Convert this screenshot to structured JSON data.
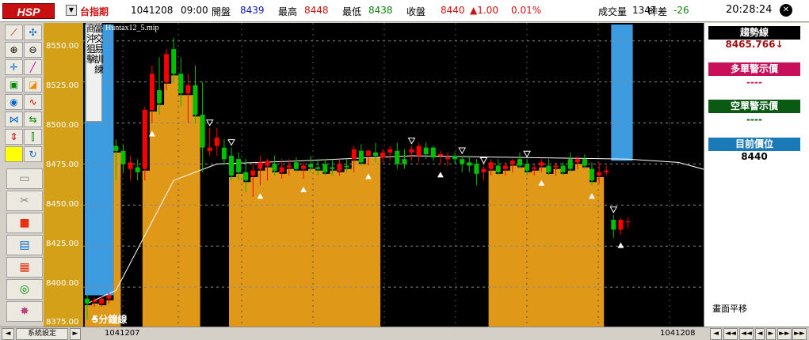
{
  "app": {
    "logo": "HSP"
  },
  "quote": {
    "symbol": "台指期",
    "date": "1041208",
    "time": "09:00",
    "open_label": "開盤",
    "open": "8439",
    "high_label": "最高",
    "high": "8448",
    "low_label": "最低",
    "low": "8438",
    "close_label": "收盤",
    "close": "8440",
    "change": "▲1.00",
    "change_pct": "0.01%",
    "volume_label": "成交量",
    "volume": "1347",
    "diff_label": "昨差",
    "diff": "-26",
    "clock": "20:28:24"
  },
  "colors": {
    "accent_up": "#ff0000",
    "accent_down": "#00c000",
    "yaxis_bg": "#d4a017",
    "zone_orange": "#e09818",
    "zone_blue": "#3d9be0"
  },
  "toolbar": {
    "icons": [
      "trend-line-icon",
      "cursor-icon",
      "zoom-in-icon",
      "zoom-out-icon",
      "crosshair-icon",
      "pencil-icon",
      "lock-icon",
      "highlight-icon",
      "gauge-icon",
      "wave-icon",
      "zigzag-icon",
      "arrows-icon",
      "up-down-arrow-icon",
      "candle-icon",
      "color-box-icon",
      "refresh-icon"
    ],
    "wide": [
      "folder-icon",
      "scissors-icon",
      "stop-icon",
      "window-icon",
      "grid-icon",
      "binoculars-icon",
      "explode-icon"
    ]
  },
  "yaxis": {
    "labels": [
      "8550.00",
      "8525.00",
      "8500.00",
      "8475.00",
      "8450.00",
      "8425.00",
      "8400.00",
      "8375.00"
    ]
  },
  "chart": {
    "vertical_tab": {
      "col1": "商沖狙擊",
      "col2": "當交易訓練"
    },
    "filename": "Huntax12_5.mip",
    "bottom_label": "5分鐘線"
  },
  "right_panel": {
    "trend_label": "趨勢線",
    "trend_value": "8465.766↓",
    "long_label": "多單警示價",
    "long_value": "----",
    "short_label": "空單警示價",
    "short_value": "----",
    "position_label": "目前價位",
    "position_value": "8440",
    "pan_label": "畫面平移",
    "header_colors": [
      "#000000",
      "#c8105a",
      "#0a5a14",
      "#1a7ab8"
    ]
  },
  "statusbar": {
    "settings": "系統設定",
    "left_date": "1041207",
    "right_date": "1041208",
    "nav": [
      "◄",
      "◄◄",
      "◄◄",
      "◄",
      "►",
      "►►",
      "►►",
      "►"
    ]
  },
  "chart_data": {
    "type": "candlestick",
    "ylim": [
      8375,
      8560
    ],
    "yticks": [
      8375,
      8400,
      8425,
      8450,
      8475,
      8500,
      8525,
      8550
    ],
    "candles": [
      {
        "o": 8393,
        "h": 8395,
        "l": 8380,
        "c": 8390
      },
      {
        "o": 8391,
        "h": 8394,
        "l": 8388,
        "c": 8392
      },
      {
        "o": 8390,
        "h": 8394,
        "l": 8388,
        "c": 8393
      },
      {
        "o": 8393,
        "h": 8397,
        "l": 8390,
        "c": 8395
      },
      {
        "o": 8486,
        "h": 8490,
        "l": 8465,
        "c": 8483
      },
      {
        "o": 8483,
        "h": 8487,
        "l": 8470,
        "c": 8475
      },
      {
        "o": 8472,
        "h": 8480,
        "l": 8465,
        "c": 8476
      },
      {
        "o": 8473,
        "h": 8478,
        "l": 8465,
        "c": 8470
      },
      {
        "o": 8472,
        "h": 8510,
        "l": 8465,
        "c": 8508
      },
      {
        "o": 8508,
        "h": 8535,
        "l": 8500,
        "c": 8530
      },
      {
        "o": 8520,
        "h": 8540,
        "l": 8505,
        "c": 8512
      },
      {
        "o": 8525,
        "h": 8545,
        "l": 8520,
        "c": 8542
      },
      {
        "o": 8545,
        "h": 8552,
        "l": 8525,
        "c": 8530
      },
      {
        "o": 8530,
        "h": 8540,
        "l": 8510,
        "c": 8518
      },
      {
        "o": 8518,
        "h": 8530,
        "l": 8500,
        "c": 8523
      },
      {
        "o": 8523,
        "h": 8535,
        "l": 8500,
        "c": 8505
      },
      {
        "o": 8505,
        "h": 8525,
        "l": 8470,
        "c": 8485
      },
      {
        "o": 8483,
        "h": 8497,
        "l": 8480,
        "c": 8485
      },
      {
        "o": 8486,
        "h": 8497,
        "l": 8480,
        "c": 8491
      },
      {
        "o": 8485,
        "h": 8490,
        "l": 8475,
        "c": 8478
      },
      {
        "o": 8480,
        "h": 8485,
        "l": 8465,
        "c": 8468
      },
      {
        "o": 8478,
        "h": 8482,
        "l": 8465,
        "c": 8470
      },
      {
        "o": 8470,
        "h": 8478,
        "l": 8458,
        "c": 8465
      },
      {
        "o": 8468,
        "h": 8475,
        "l": 8455,
        "c": 8471
      },
      {
        "o": 8472,
        "h": 8480,
        "l": 8462,
        "c": 8476
      },
      {
        "o": 8474,
        "h": 8478,
        "l": 8465,
        "c": 8477
      },
      {
        "o": 8475,
        "h": 8480,
        "l": 8468,
        "c": 8471
      },
      {
        "o": 8470,
        "h": 8478,
        "l": 8466,
        "c": 8473
      },
      {
        "o": 8473,
        "h": 8478,
        "l": 8468,
        "c": 8474
      },
      {
        "o": 8476,
        "h": 8479,
        "l": 8470,
        "c": 8472
      },
      {
        "o": 8472,
        "h": 8476,
        "l": 8466,
        "c": 8474
      },
      {
        "o": 8475,
        "h": 8480,
        "l": 8470,
        "c": 8473
      },
      {
        "o": 8473,
        "h": 8478,
        "l": 8468,
        "c": 8472
      },
      {
        "o": 8475,
        "h": 8478,
        "l": 8468,
        "c": 8470
      },
      {
        "o": 8473,
        "h": 8478,
        "l": 8468,
        "c": 8472
      },
      {
        "o": 8471,
        "h": 8478,
        "l": 8468,
        "c": 8475
      },
      {
        "o": 8474,
        "h": 8478,
        "l": 8470,
        "c": 8473
      },
      {
        "o": 8478,
        "h": 8486,
        "l": 8470,
        "c": 8484
      },
      {
        "o": 8483,
        "h": 8487,
        "l": 8474,
        "c": 8476
      },
      {
        "o": 8480,
        "h": 8484,
        "l": 8474,
        "c": 8483
      },
      {
        "o": 8482,
        "h": 8488,
        "l": 8476,
        "c": 8480
      },
      {
        "o": 8479,
        "h": 8484,
        "l": 8476,
        "c": 8482
      },
      {
        "o": 8482,
        "h": 8486,
        "l": 8477,
        "c": 8484
      },
      {
        "o": 8483,
        "h": 8488,
        "l": 8472,
        "c": 8475
      },
      {
        "o": 8478,
        "h": 8484,
        "l": 8472,
        "c": 8475
      },
      {
        "o": 8482,
        "h": 8486,
        "l": 8477,
        "c": 8484
      },
      {
        "o": 8480,
        "h": 8488,
        "l": 8476,
        "c": 8486
      },
      {
        "o": 8485,
        "h": 8488,
        "l": 8478,
        "c": 8481
      },
      {
        "o": 8485,
        "h": 8486,
        "l": 8477,
        "c": 8479
      },
      {
        "o": 8480,
        "h": 8483,
        "l": 8475,
        "c": 8481
      },
      {
        "o": 8478,
        "h": 8482,
        "l": 8474,
        "c": 8479
      },
      {
        "o": 8480,
        "h": 8482,
        "l": 8475,
        "c": 8478
      },
      {
        "o": 8478,
        "h": 8480,
        "l": 8470,
        "c": 8475
      },
      {
        "o": 8476,
        "h": 8480,
        "l": 8470,
        "c": 8474
      },
      {
        "o": 8475,
        "h": 8478,
        "l": 8462,
        "c": 8469
      },
      {
        "o": 8470,
        "h": 8474,
        "l": 8465,
        "c": 8472
      },
      {
        "o": 8472,
        "h": 8478,
        "l": 8468,
        "c": 8476
      },
      {
        "o": 8474,
        "h": 8478,
        "l": 8468,
        "c": 8470
      },
      {
        "o": 8472,
        "h": 8476,
        "l": 8468,
        "c": 8474
      },
      {
        "o": 8475,
        "h": 8478,
        "l": 8470,
        "c": 8477
      },
      {
        "o": 8478,
        "h": 8482,
        "l": 8472,
        "c": 8474
      },
      {
        "o": 8475,
        "h": 8478,
        "l": 8468,
        "c": 8471
      },
      {
        "o": 8472,
        "h": 8475,
        "l": 8468,
        "c": 8473
      },
      {
        "o": 8474,
        "h": 8478,
        "l": 8470,
        "c": 8476
      },
      {
        "o": 8474,
        "h": 8478,
        "l": 8468,
        "c": 8470
      },
      {
        "o": 8473,
        "h": 8476,
        "l": 8468,
        "c": 8474
      },
      {
        "o": 8474,
        "h": 8476,
        "l": 8468,
        "c": 8470
      },
      {
        "o": 8478,
        "h": 8482,
        "l": 8470,
        "c": 8472
      },
      {
        "o": 8476,
        "h": 8480,
        "l": 8472,
        "c": 8478
      },
      {
        "o": 8478,
        "h": 8481,
        "l": 8472,
        "c": 8474
      },
      {
        "o": 8472,
        "h": 8476,
        "l": 8462,
        "c": 8465
      },
      {
        "o": 8468,
        "h": 8476,
        "l": 8463,
        "c": 8470
      },
      {
        "o": 8470,
        "h": 8474,
        "l": 8468,
        "c": 8471
      },
      {
        "o": 8441,
        "h": 8444,
        "l": 8430,
        "c": 8435
      },
      {
        "o": 8435,
        "h": 8442,
        "l": 8432,
        "c": 8441
      },
      {
        "o": 8440,
        "h": 8442,
        "l": 8436,
        "c": 8440
      }
    ],
    "trend_line": [
      [
        0,
        8390
      ],
      [
        4,
        8398
      ],
      [
        12,
        8465
      ],
      [
        18,
        8475
      ],
      [
        30,
        8477
      ],
      [
        45,
        8480
      ],
      [
        60,
        8479
      ],
      [
        75,
        8478
      ],
      [
        82,
        8476
      ],
      [
        87,
        8470
      ]
    ],
    "orange_zones": [
      {
        "from": 0,
        "to": 4,
        "top": 8392
      },
      {
        "from": 8,
        "to": 15,
        "top": 8505
      },
      {
        "from": 20,
        "to": 40,
        "top": 8472
      },
      {
        "from": 56,
        "to": 71,
        "top": 8468
      }
    ],
    "blue_zones": [
      {
        "from": 0,
        "to": 3,
        "top": 8560,
        "bottom": 8395
      },
      {
        "from": 73,
        "to": 75,
        "top": 8560,
        "bottom": 8477
      }
    ]
  }
}
